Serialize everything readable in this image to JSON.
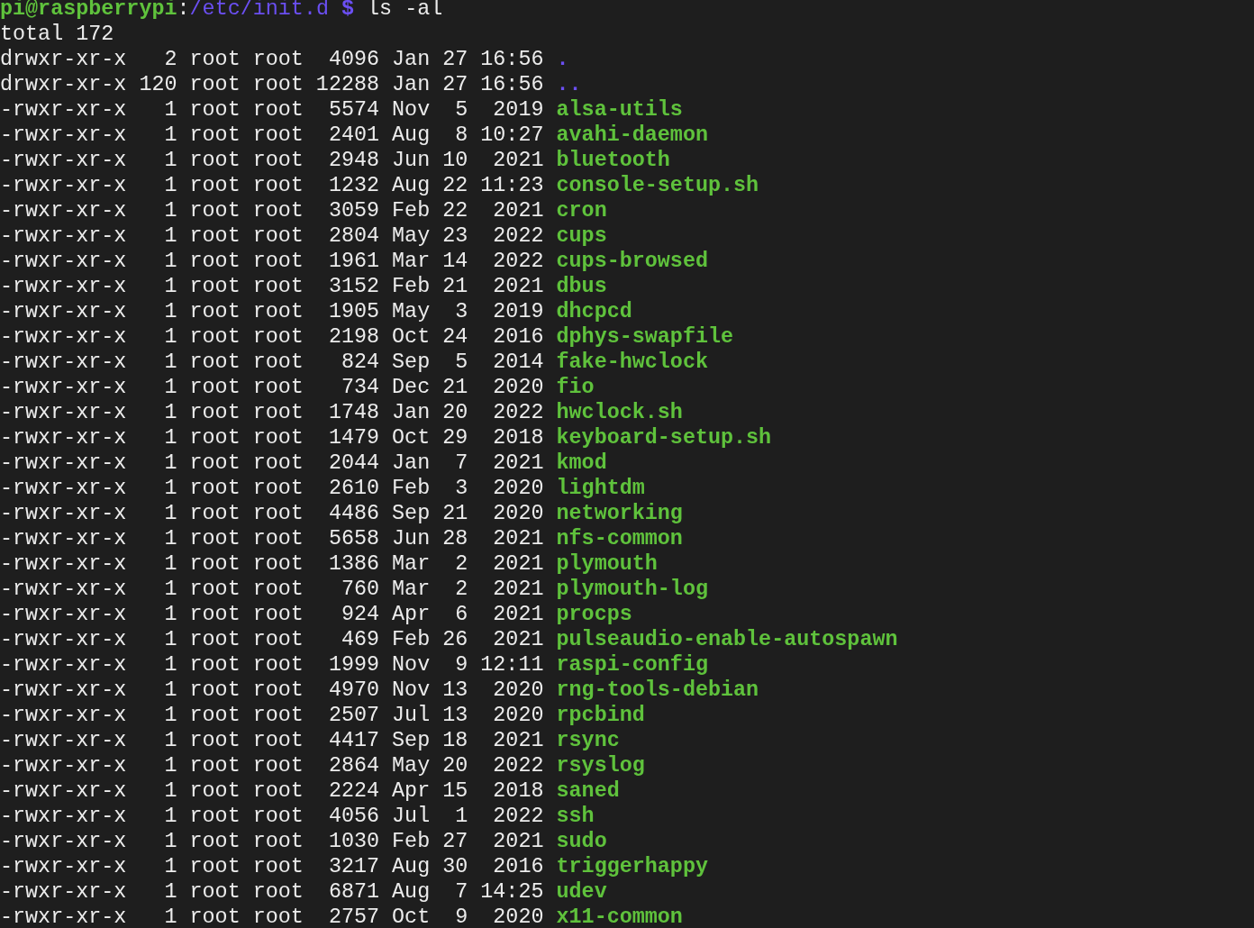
{
  "prompt": {
    "user": "pi@raspberrypi",
    "separator": ":",
    "path": "/etc/init.d",
    "symbol": "$",
    "command": "ls -al"
  },
  "total": "total 172",
  "entries": [
    {
      "kind": "directory",
      "permissions": "drwxr-xr-x",
      "links": "2",
      "owner": "root",
      "group": "root",
      "size": "4096",
      "month": "Jan",
      "day": "27",
      "time": "16:56",
      "name": "."
    },
    {
      "kind": "directory",
      "permissions": "drwxr-xr-x",
      "links": "120",
      "owner": "root",
      "group": "root",
      "size": "12288",
      "month": "Jan",
      "day": "27",
      "time": "16:56",
      "name": ".."
    },
    {
      "kind": "executable",
      "permissions": "-rwxr-xr-x",
      "links": "1",
      "owner": "root",
      "group": "root",
      "size": "5574",
      "month": "Nov",
      "day": "5",
      "time": "2019",
      "name": "alsa-utils"
    },
    {
      "kind": "executable",
      "permissions": "-rwxr-xr-x",
      "links": "1",
      "owner": "root",
      "group": "root",
      "size": "2401",
      "month": "Aug",
      "day": "8",
      "time": "10:27",
      "name": "avahi-daemon"
    },
    {
      "kind": "executable",
      "permissions": "-rwxr-xr-x",
      "links": "1",
      "owner": "root",
      "group": "root",
      "size": "2948",
      "month": "Jun",
      "day": "10",
      "time": "2021",
      "name": "bluetooth"
    },
    {
      "kind": "executable",
      "permissions": "-rwxr-xr-x",
      "links": "1",
      "owner": "root",
      "group": "root",
      "size": "1232",
      "month": "Aug",
      "day": "22",
      "time": "11:23",
      "name": "console-setup.sh"
    },
    {
      "kind": "executable",
      "permissions": "-rwxr-xr-x",
      "links": "1",
      "owner": "root",
      "group": "root",
      "size": "3059",
      "month": "Feb",
      "day": "22",
      "time": "2021",
      "name": "cron"
    },
    {
      "kind": "executable",
      "permissions": "-rwxr-xr-x",
      "links": "1",
      "owner": "root",
      "group": "root",
      "size": "2804",
      "month": "May",
      "day": "23",
      "time": "2022",
      "name": "cups"
    },
    {
      "kind": "executable",
      "permissions": "-rwxr-xr-x",
      "links": "1",
      "owner": "root",
      "group": "root",
      "size": "1961",
      "month": "Mar",
      "day": "14",
      "time": "2022",
      "name": "cups-browsed"
    },
    {
      "kind": "executable",
      "permissions": "-rwxr-xr-x",
      "links": "1",
      "owner": "root",
      "group": "root",
      "size": "3152",
      "month": "Feb",
      "day": "21",
      "time": "2021",
      "name": "dbus"
    },
    {
      "kind": "executable",
      "permissions": "-rwxr-xr-x",
      "links": "1",
      "owner": "root",
      "group": "root",
      "size": "1905",
      "month": "May",
      "day": "3",
      "time": "2019",
      "name": "dhcpcd"
    },
    {
      "kind": "executable",
      "permissions": "-rwxr-xr-x",
      "links": "1",
      "owner": "root",
      "group": "root",
      "size": "2198",
      "month": "Oct",
      "day": "24",
      "time": "2016",
      "name": "dphys-swapfile"
    },
    {
      "kind": "executable",
      "permissions": "-rwxr-xr-x",
      "links": "1",
      "owner": "root",
      "group": "root",
      "size": "824",
      "month": "Sep",
      "day": "5",
      "time": "2014",
      "name": "fake-hwclock"
    },
    {
      "kind": "executable",
      "permissions": "-rwxr-xr-x",
      "links": "1",
      "owner": "root",
      "group": "root",
      "size": "734",
      "month": "Dec",
      "day": "21",
      "time": "2020",
      "name": "fio"
    },
    {
      "kind": "executable",
      "permissions": "-rwxr-xr-x",
      "links": "1",
      "owner": "root",
      "group": "root",
      "size": "1748",
      "month": "Jan",
      "day": "20",
      "time": "2022",
      "name": "hwclock.sh"
    },
    {
      "kind": "executable",
      "permissions": "-rwxr-xr-x",
      "links": "1",
      "owner": "root",
      "group": "root",
      "size": "1479",
      "month": "Oct",
      "day": "29",
      "time": "2018",
      "name": "keyboard-setup.sh"
    },
    {
      "kind": "executable",
      "permissions": "-rwxr-xr-x",
      "links": "1",
      "owner": "root",
      "group": "root",
      "size": "2044",
      "month": "Jan",
      "day": "7",
      "time": "2021",
      "name": "kmod"
    },
    {
      "kind": "executable",
      "permissions": "-rwxr-xr-x",
      "links": "1",
      "owner": "root",
      "group": "root",
      "size": "2610",
      "month": "Feb",
      "day": "3",
      "time": "2020",
      "name": "lightdm"
    },
    {
      "kind": "executable",
      "permissions": "-rwxr-xr-x",
      "links": "1",
      "owner": "root",
      "group": "root",
      "size": "4486",
      "month": "Sep",
      "day": "21",
      "time": "2020",
      "name": "networking"
    },
    {
      "kind": "executable",
      "permissions": "-rwxr-xr-x",
      "links": "1",
      "owner": "root",
      "group": "root",
      "size": "5658",
      "month": "Jun",
      "day": "28",
      "time": "2021",
      "name": "nfs-common"
    },
    {
      "kind": "executable",
      "permissions": "-rwxr-xr-x",
      "links": "1",
      "owner": "root",
      "group": "root",
      "size": "1386",
      "month": "Mar",
      "day": "2",
      "time": "2021",
      "name": "plymouth"
    },
    {
      "kind": "executable",
      "permissions": "-rwxr-xr-x",
      "links": "1",
      "owner": "root",
      "group": "root",
      "size": "760",
      "month": "Mar",
      "day": "2",
      "time": "2021",
      "name": "plymouth-log"
    },
    {
      "kind": "executable",
      "permissions": "-rwxr-xr-x",
      "links": "1",
      "owner": "root",
      "group": "root",
      "size": "924",
      "month": "Apr",
      "day": "6",
      "time": "2021",
      "name": "procps"
    },
    {
      "kind": "executable",
      "permissions": "-rwxr-xr-x",
      "links": "1",
      "owner": "root",
      "group": "root",
      "size": "469",
      "month": "Feb",
      "day": "26",
      "time": "2021",
      "name": "pulseaudio-enable-autospawn"
    },
    {
      "kind": "executable",
      "permissions": "-rwxr-xr-x",
      "links": "1",
      "owner": "root",
      "group": "root",
      "size": "1999",
      "month": "Nov",
      "day": "9",
      "time": "12:11",
      "name": "raspi-config"
    },
    {
      "kind": "executable",
      "permissions": "-rwxr-xr-x",
      "links": "1",
      "owner": "root",
      "group": "root",
      "size": "4970",
      "month": "Nov",
      "day": "13",
      "time": "2020",
      "name": "rng-tools-debian"
    },
    {
      "kind": "executable",
      "permissions": "-rwxr-xr-x",
      "links": "1",
      "owner": "root",
      "group": "root",
      "size": "2507",
      "month": "Jul",
      "day": "13",
      "time": "2020",
      "name": "rpcbind"
    },
    {
      "kind": "executable",
      "permissions": "-rwxr-xr-x",
      "links": "1",
      "owner": "root",
      "group": "root",
      "size": "4417",
      "month": "Sep",
      "day": "18",
      "time": "2021",
      "name": "rsync"
    },
    {
      "kind": "executable",
      "permissions": "-rwxr-xr-x",
      "links": "1",
      "owner": "root",
      "group": "root",
      "size": "2864",
      "month": "May",
      "day": "20",
      "time": "2022",
      "name": "rsyslog"
    },
    {
      "kind": "executable",
      "permissions": "-rwxr-xr-x",
      "links": "1",
      "owner": "root",
      "group": "root",
      "size": "2224",
      "month": "Apr",
      "day": "15",
      "time": "2018",
      "name": "saned"
    },
    {
      "kind": "executable",
      "permissions": "-rwxr-xr-x",
      "links": "1",
      "owner": "root",
      "group": "root",
      "size": "4056",
      "month": "Jul",
      "day": "1",
      "time": "2022",
      "name": "ssh"
    },
    {
      "kind": "executable",
      "permissions": "-rwxr-xr-x",
      "links": "1",
      "owner": "root",
      "group": "root",
      "size": "1030",
      "month": "Feb",
      "day": "27",
      "time": "2021",
      "name": "sudo"
    },
    {
      "kind": "executable",
      "permissions": "-rwxr-xr-x",
      "links": "1",
      "owner": "root",
      "group": "root",
      "size": "3217",
      "month": "Aug",
      "day": "30",
      "time": "2016",
      "name": "triggerhappy"
    },
    {
      "kind": "executable",
      "permissions": "-rwxr-xr-x",
      "links": "1",
      "owner": "root",
      "group": "root",
      "size": "6871",
      "month": "Aug",
      "day": "7",
      "time": "14:25",
      "name": "udev"
    },
    {
      "kind": "executable",
      "permissions": "-rwxr-xr-x",
      "links": "1",
      "owner": "root",
      "group": "root",
      "size": "2757",
      "month": "Oct",
      "day": "9",
      "time": "2020",
      "name": "x11-common"
    }
  ]
}
